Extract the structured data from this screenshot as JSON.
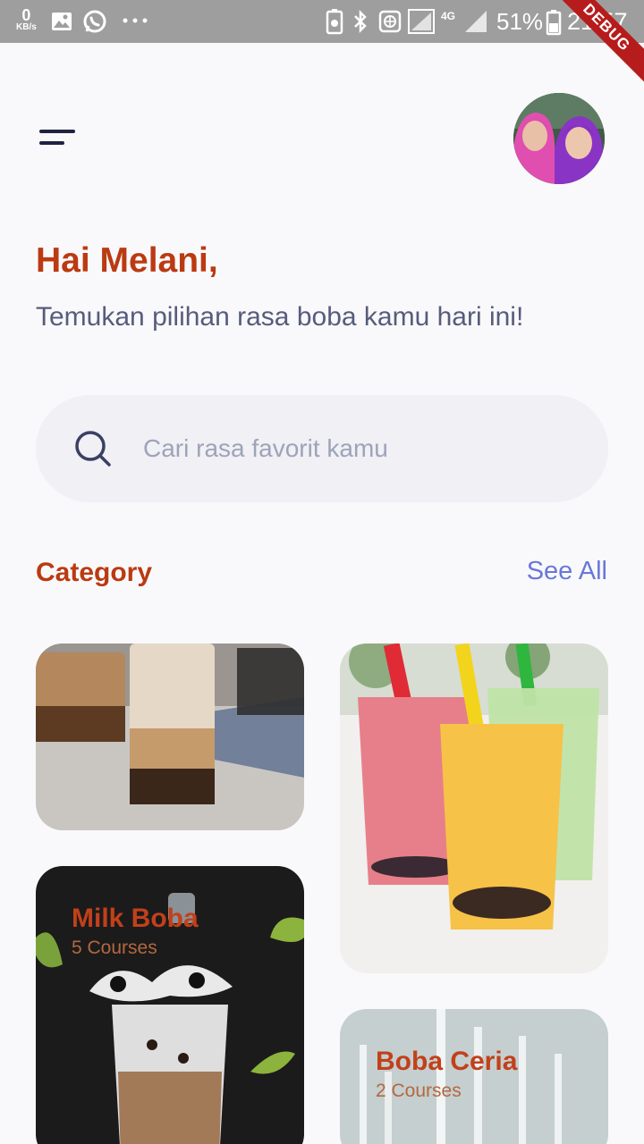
{
  "status_bar": {
    "net_speed_value": "0",
    "net_speed_unit": "KB/s",
    "network_type": "4G",
    "battery_percent": "51%",
    "time": "21:57",
    "debug_label": "DEBUG"
  },
  "header": {
    "menu_icon": "hamburger-menu-icon",
    "avatar_icon": "profile-photo"
  },
  "greeting": {
    "title": "Hai Melani,",
    "subtitle": "Temukan pilihan rasa boba kamu hari ini!"
  },
  "search": {
    "placeholder": "Cari rasa favorit kamu",
    "icon": "search-icon"
  },
  "category": {
    "title": "Category",
    "see_all": "See All",
    "cards": [
      {
        "title": "",
        "subtitle": ""
      },
      {
        "title": "",
        "subtitle": ""
      },
      {
        "title": "Milk Boba",
        "subtitle": "5 Courses"
      },
      {
        "title": "Boba Ceria",
        "subtitle": "2 Courses"
      }
    ]
  },
  "colors": {
    "accent": "#bb3a12",
    "link": "#6a78d8",
    "text_secondary": "#575c7c",
    "search_bg": "#f0f0f5",
    "debug": "#b71c1c"
  }
}
